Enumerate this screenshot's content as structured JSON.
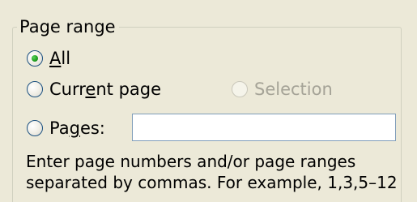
{
  "group": {
    "legend": "Page range"
  },
  "options": {
    "all": {
      "pre": "",
      "accel": "A",
      "post": "ll",
      "selected": true,
      "enabled": true
    },
    "current_page": {
      "pre": "Curr",
      "accel": "e",
      "post": "nt page",
      "selected": false,
      "enabled": true
    },
    "selection": {
      "pre": "",
      "accel": "",
      "post": "Selection",
      "selected": false,
      "enabled": false
    },
    "pages": {
      "pre": "Pa",
      "accel": "g",
      "post": "es:",
      "selected": false,
      "enabled": true
    }
  },
  "pages_input": {
    "value": ""
  },
  "help": {
    "line1": "Enter page numbers and/or page ranges",
    "line2": "separated by commas.  For example, 1,3,5–12"
  },
  "colors": {
    "dialog_bg": "#ece9d8",
    "disabled_text": "#a5a397",
    "radio_dot": "#21a121",
    "input_border": "#7f9db9"
  }
}
